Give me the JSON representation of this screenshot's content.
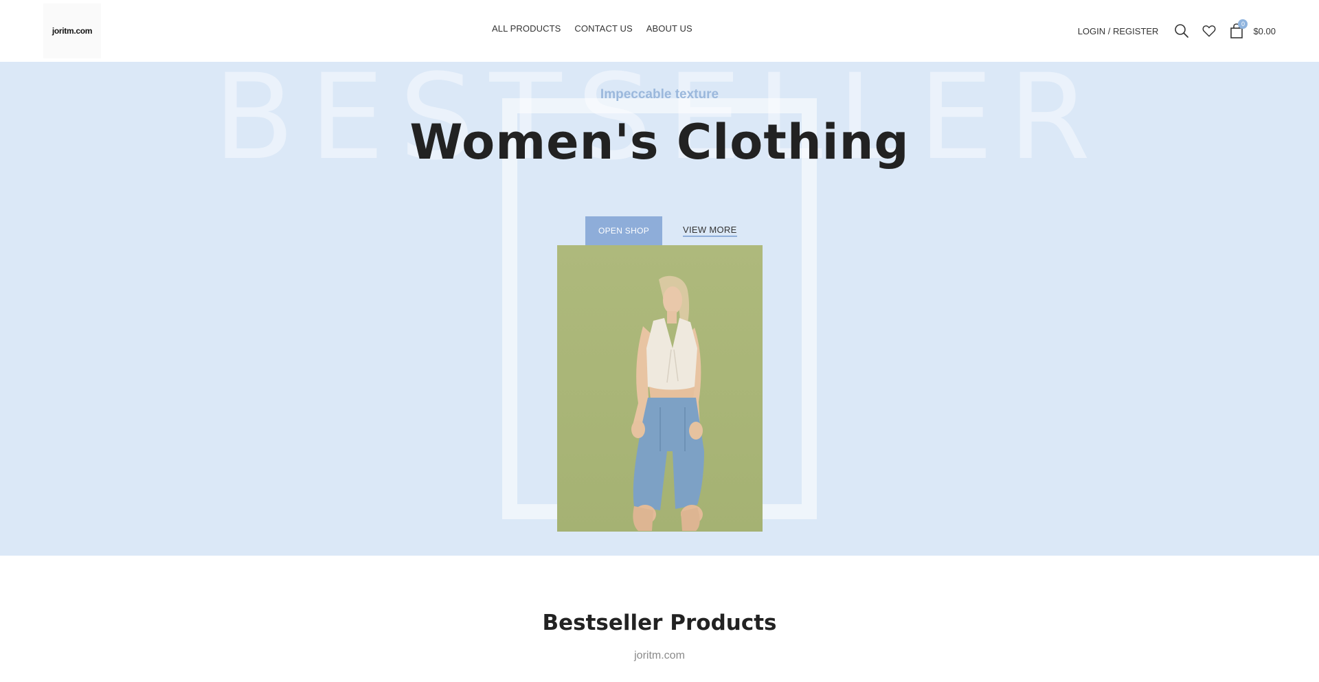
{
  "header": {
    "logo_text": "joritm.com",
    "nav": [
      {
        "label": "ALL PRODUCTS"
      },
      {
        "label": "CONTACT US"
      },
      {
        "label": "ABOUT US"
      }
    ],
    "login_label": "LOGIN / REGISTER",
    "cart_count": "0",
    "cart_total": "$0.00"
  },
  "hero": {
    "background_word": "BESTSELLER",
    "subtitle": "Impeccable texture",
    "title": "Women's Clothing",
    "primary_button": "OPEN SHOP",
    "secondary_link": "VIEW MORE",
    "background_color": "#dbe8f7",
    "accent_color": "#8eadd9"
  },
  "section": {
    "title": "Bestseller Products",
    "subtitle": "joritm.com"
  },
  "icons": [
    "search-icon",
    "heart-icon",
    "shopping-bag-icon"
  ]
}
